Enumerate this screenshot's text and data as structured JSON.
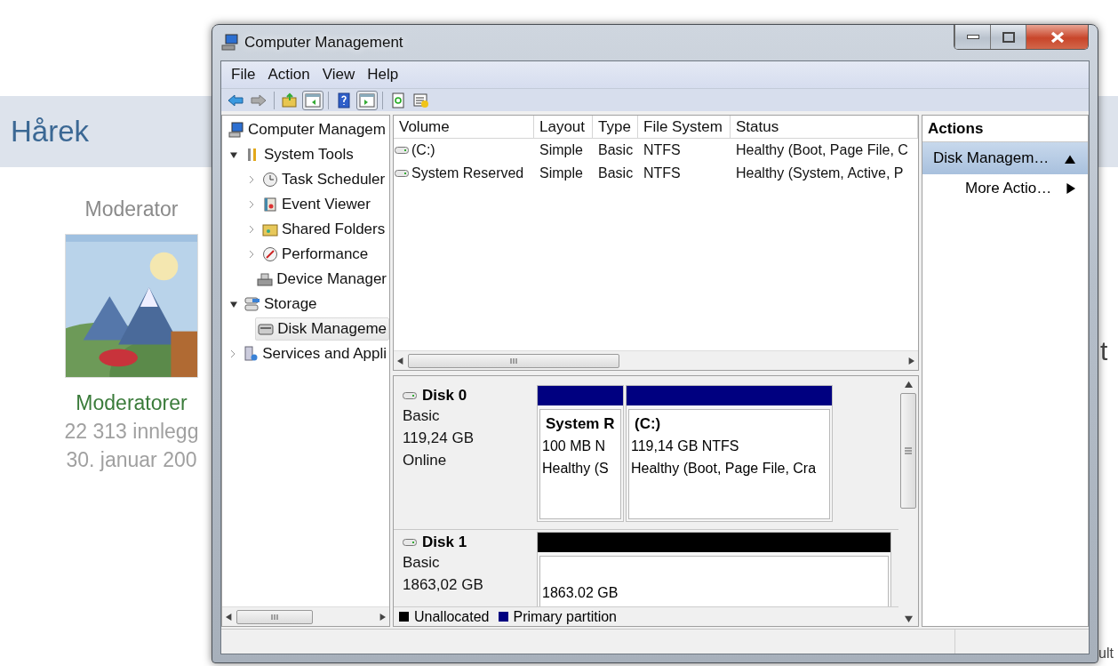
{
  "background_page": {
    "heading": "Hårek",
    "role": "Moderator",
    "group": "Moderatorer",
    "post_count": "22 313 innlegg",
    "joined": "30. januar 200",
    "avatar": {
      "kind": "picture"
    },
    "fragments": [
      "t",
      "ult"
    ]
  },
  "window": {
    "title": "Computer Management"
  },
  "menu": [
    "File",
    "Action",
    "View",
    "Help"
  ],
  "toolbar": [
    {
      "kind": "back",
      "pressed": false
    },
    {
      "kind": "forward",
      "pressed": false
    },
    {
      "kind": "separator"
    },
    {
      "kind": "up-folder",
      "pressed": false
    },
    {
      "kind": "console-tree",
      "pressed": true
    },
    {
      "kind": "separator"
    },
    {
      "kind": "help",
      "pressed": false
    },
    {
      "kind": "action-pane",
      "pressed": true
    },
    {
      "kind": "separator"
    },
    {
      "kind": "refresh",
      "pressed": false
    },
    {
      "kind": "properties",
      "pressed": false
    }
  ],
  "tree": [
    {
      "label": "Computer Managem",
      "kind": "computer",
      "selected": false,
      "children": [
        {
          "label": "System Tools",
          "kind": "tools",
          "selected": false,
          "expanded": true,
          "children": [
            {
              "label": "Task Scheduler",
              "kind": "clock",
              "selected": false,
              "expanded": false
            },
            {
              "label": "Event Viewer",
              "kind": "log",
              "selected": false,
              "expanded": false
            },
            {
              "label": "Shared Folders",
              "kind": "share",
              "selected": false,
              "expanded": false
            },
            {
              "label": "Performance",
              "kind": "perf",
              "selected": false,
              "expanded": false
            },
            {
              "label": "Device Manager",
              "kind": "device",
              "selected": false
            }
          ]
        },
        {
          "label": "Storage",
          "kind": "storage",
          "selected": false,
          "expanded": true,
          "children": [
            {
              "label": "Disk Manageme",
              "kind": "disk",
              "selected": true
            }
          ]
        },
        {
          "label": "Services and Appli",
          "kind": "services",
          "selected": false,
          "expanded": false
        }
      ]
    }
  ],
  "volumes": {
    "columns": [
      "Volume",
      "Layout",
      "Type",
      "File System",
      "Status"
    ],
    "rows": [
      [
        "(C:)",
        "Simple",
        "Basic",
        "NTFS",
        "Healthy (Boot, Page File, C"
      ],
      [
        "System Reserved",
        "Simple",
        "Basic",
        "NTFS",
        "Healthy (System, Active, P"
      ]
    ]
  },
  "disks": [
    {
      "name": "Disk 0",
      "type": "Basic",
      "size": "119,24 GB",
      "status": "Online",
      "partitions": [
        {
          "title": "System R",
          "detail": "100 MB N",
          "status": "Healthy (S",
          "color": "#000080"
        },
        {
          "title": "(C:)",
          "detail": "119,14 GB NTFS",
          "status": "Healthy (Boot, Page File, Cra",
          "color": "#000080"
        }
      ]
    },
    {
      "name": "Disk 1",
      "type": "Basic",
      "size": "1863,02 GB",
      "partitions": [
        {
          "detail": "1863.02 GB",
          "color": "#000000"
        }
      ]
    }
  ],
  "legend": [
    {
      "label": "Unallocated",
      "color": "#000000"
    },
    {
      "label": "Primary partition",
      "color": "#000080"
    }
  ],
  "actions": {
    "title": "Actions",
    "items": [
      {
        "label": "Disk Managem…",
        "kind": "section",
        "selected": true
      },
      {
        "label": "More Actio…",
        "kind": "item",
        "selected": false
      }
    ]
  }
}
